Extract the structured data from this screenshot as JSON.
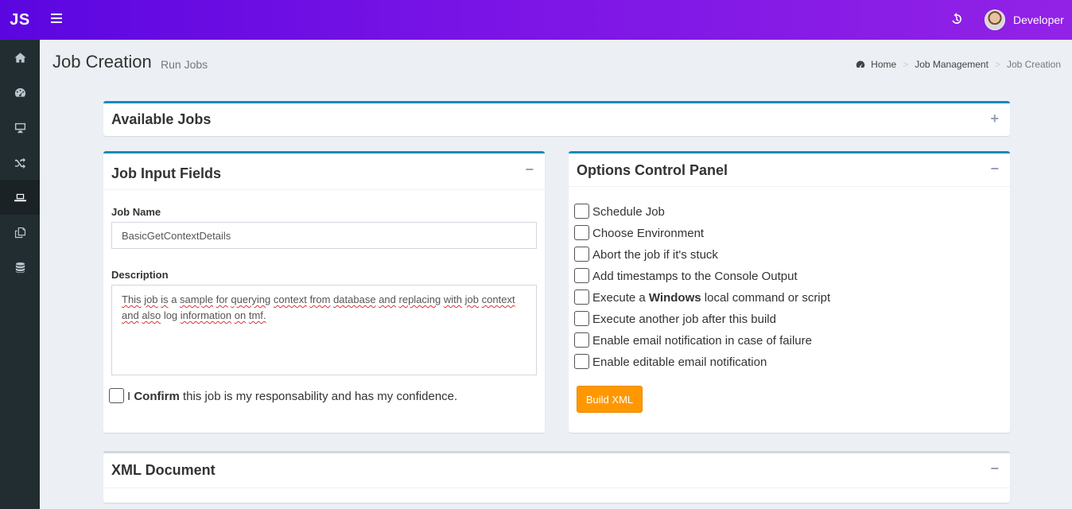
{
  "header": {
    "logo": "JS",
    "username": "Developer"
  },
  "page": {
    "title": "Job Creation",
    "subtitle": "Run Jobs"
  },
  "breadcrumb": {
    "home": "Home",
    "section": "Job Management",
    "current": "Job Creation"
  },
  "available_jobs": {
    "title": "Available Jobs",
    "toggle": "+"
  },
  "job_input": {
    "title": "Job Input Fields",
    "toggle": "−",
    "job_name_label": "Job Name",
    "job_name_value": "BasicGetContextDetails",
    "description_label": "Description",
    "description_words_1": [
      "This",
      "job",
      "is",
      "a",
      "sample",
      "for",
      "querying",
      "context",
      "from",
      "database",
      "and",
      "replacing",
      "with",
      "job",
      "context"
    ],
    "description_words_2": [
      "and",
      "also",
      "log",
      "information",
      "on",
      "tmf."
    ],
    "confirm_prefix": "I",
    "confirm_bold": "Confirm",
    "confirm_suffix": "this job is my responsability and has my confidence."
  },
  "options_panel": {
    "title": "Options Control Panel",
    "toggle": "−",
    "opt1": "Schedule Job",
    "opt2": "Choose Environment",
    "opt3": "Abort the job if it's stuck",
    "opt4": "Add timestamps to the Console Output",
    "opt5_prefix": "Execute a",
    "opt5_bold": "Windows",
    "opt5_suffix": "local command or script",
    "opt6": "Execute another job after this build",
    "opt7": "Enable email notification in case of failure",
    "opt8": "Enable editable email notification",
    "build_button": "Build XML"
  },
  "xml_document": {
    "title": "XML Document",
    "toggle": "−"
  },
  "icons": {
    "sidebar": [
      "home-icon",
      "dashboard-icon",
      "desktop-icon",
      "random-icon",
      "laptop-icon",
      "copy-icon",
      "database-icon"
    ],
    "header": [
      "hamburger-icon",
      "history-icon"
    ]
  },
  "colors": {
    "header_gradient_start": "#5b06e0",
    "header_gradient_end": "#9222e6",
    "box_accent": "#1a8bb8",
    "button_orange": "#ff9800",
    "sidebar_bg": "#222d32"
  }
}
